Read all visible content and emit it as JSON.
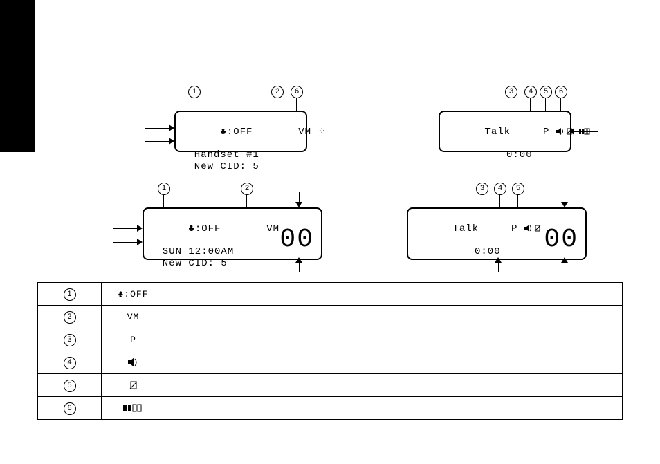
{
  "lcd_top_left": {
    "line1_left": "♣:OFF",
    "line1_right": "VM ⁘",
    "line2": "  Handset #1",
    "line3": "  New CID: 5"
  },
  "lcd_top_right": {
    "line1_left": "Talk",
    "line1_right_p": "P",
    "line2_right": "0:00"
  },
  "lcd_bot_left": {
    "line1_left": "♣:OFF",
    "line1_right": "VM",
    "line2": "  SUN 12:00AM",
    "line3": "  New CID: 5",
    "seg": "00"
  },
  "lcd_bot_right": {
    "line1_left": "Talk",
    "line1_right_p": "P",
    "line2_right": "0:00",
    "seg": "00"
  },
  "callouts": {
    "1": "1",
    "2": "2",
    "3": "3",
    "4": "4",
    "5": "5",
    "6": "6"
  },
  "legend": [
    {
      "num": "1",
      "icon": "♣:OFF"
    },
    {
      "num": "2",
      "icon": "VM"
    },
    {
      "num": "3",
      "icon": "P"
    },
    {
      "num": "4",
      "icon": "SPEAKER"
    },
    {
      "num": "5",
      "icon": "MUTE"
    },
    {
      "num": "6",
      "icon": "BATTERY"
    }
  ]
}
